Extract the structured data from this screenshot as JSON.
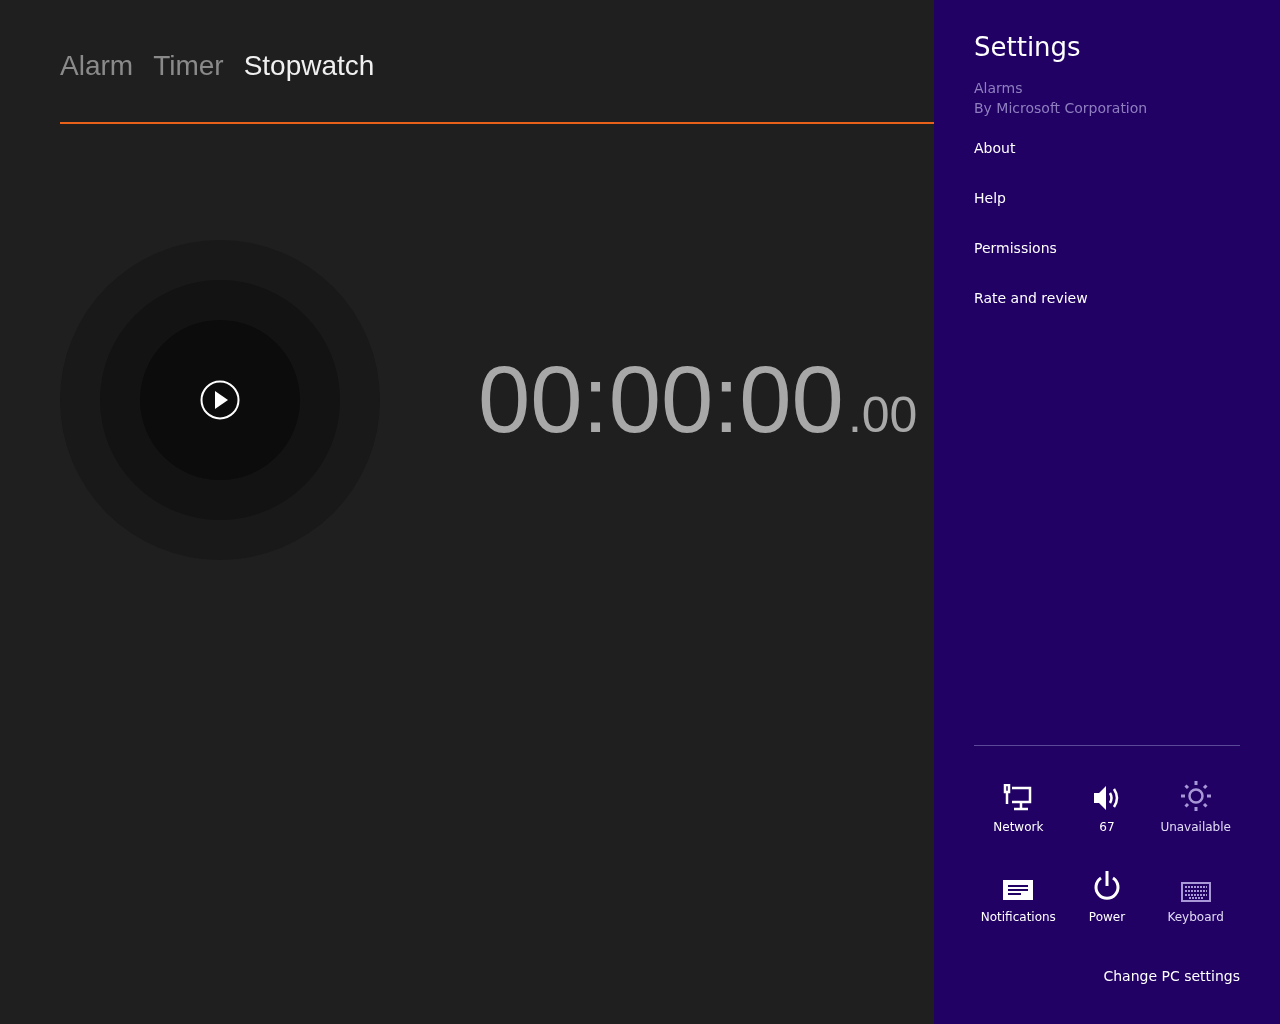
{
  "tabs": [
    {
      "label": "Alarm",
      "selected": false
    },
    {
      "label": "Timer",
      "selected": false
    },
    {
      "label": "Stopwatch",
      "selected": true
    }
  ],
  "stopwatch": {
    "time": "00:00:00",
    "fraction": ".00"
  },
  "settings": {
    "title": "Settings",
    "app_name": "Alarms",
    "publisher": "By Microsoft Corporation",
    "links": [
      "About",
      "Help",
      "Permissions",
      "Rate and review"
    ],
    "quick_settings": [
      {
        "kind": "network",
        "label": "Network",
        "disabled": false
      },
      {
        "kind": "volume",
        "label": "67",
        "disabled": false
      },
      {
        "kind": "brightness",
        "label": "Unavailable",
        "disabled": true
      },
      {
        "kind": "notifications",
        "label": "Notifications",
        "disabled": false
      },
      {
        "kind": "power",
        "label": "Power",
        "disabled": false
      },
      {
        "kind": "keyboard",
        "label": "Keyboard",
        "disabled": true
      }
    ],
    "change_pc_settings": "Change PC settings"
  }
}
